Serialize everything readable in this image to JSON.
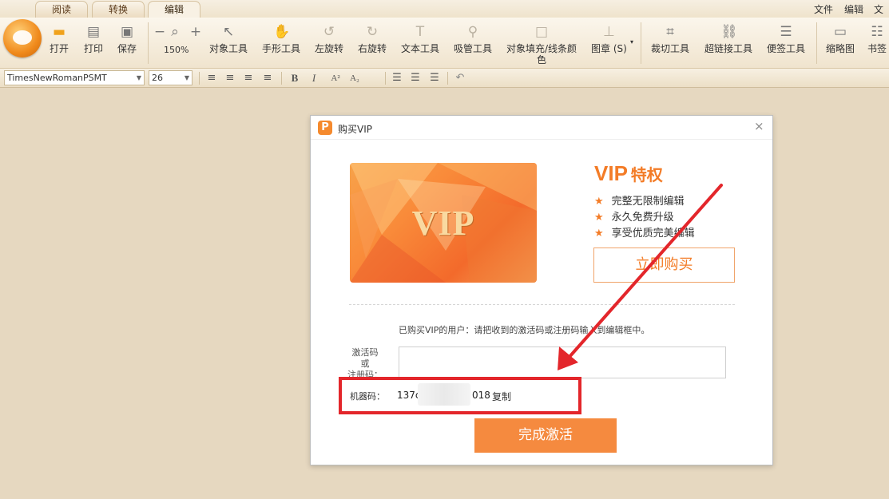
{
  "tabs": [
    {
      "label": "阅读",
      "active": false
    },
    {
      "label": "转换",
      "active": false
    },
    {
      "label": "编辑",
      "active": true
    }
  ],
  "top_menu": [
    "文件",
    "编辑",
    "文档"
  ],
  "toolbar": {
    "open": "打开",
    "print": "打印",
    "save": "保存",
    "zoom_minus": "−",
    "zoom_plus": "+",
    "zoom_level": "150%",
    "object_tool": "对象工具",
    "hand_tool": "手形工具",
    "rotate_left": "左旋转",
    "rotate_right": "右旋转",
    "text_tool": "文本工具",
    "eyedropper": "吸管工具",
    "object_fill_line1": "对象填充/线条颜",
    "object_fill_line2": "色",
    "stamp": "图章 (S)",
    "crop_tool": "裁切工具",
    "link_tool": "超链接工具",
    "note_tool": "便签工具",
    "thumbnail": "缩略图",
    "bookmark": "书签"
  },
  "format_bar": {
    "font_name": "TimesNewRomanPSMT",
    "font_size": "26",
    "bold": "B",
    "italic": "I",
    "superscript": "A²",
    "subscript": "A₂"
  },
  "dialog": {
    "title": "购买VIP",
    "app_icon_letter": "P",
    "close": "×",
    "card_text": "VIP",
    "vip_big": "VIP",
    "vip_small": "特权",
    "perks": [
      "完整无限制编辑",
      "永久免费升级",
      "享受优质完美编辑"
    ],
    "buy_button": "立即购买",
    "hint": "已购买VIP的用户：请把收到的激活码或注册码输入到编辑框中。",
    "code_label_lines": [
      "激活码",
      "或",
      "注册码："
    ],
    "code_input_value": "",
    "machine_label": "机器码：",
    "machine_code_start": "137c",
    "machine_code_end": "018",
    "copy_link": "复制",
    "activate_button": "完成激活"
  },
  "colors": {
    "accent": "#f37c27",
    "activate_bg": "#f58a3f",
    "annotation_red": "#e3262b",
    "background": "#e6d8c0"
  }
}
